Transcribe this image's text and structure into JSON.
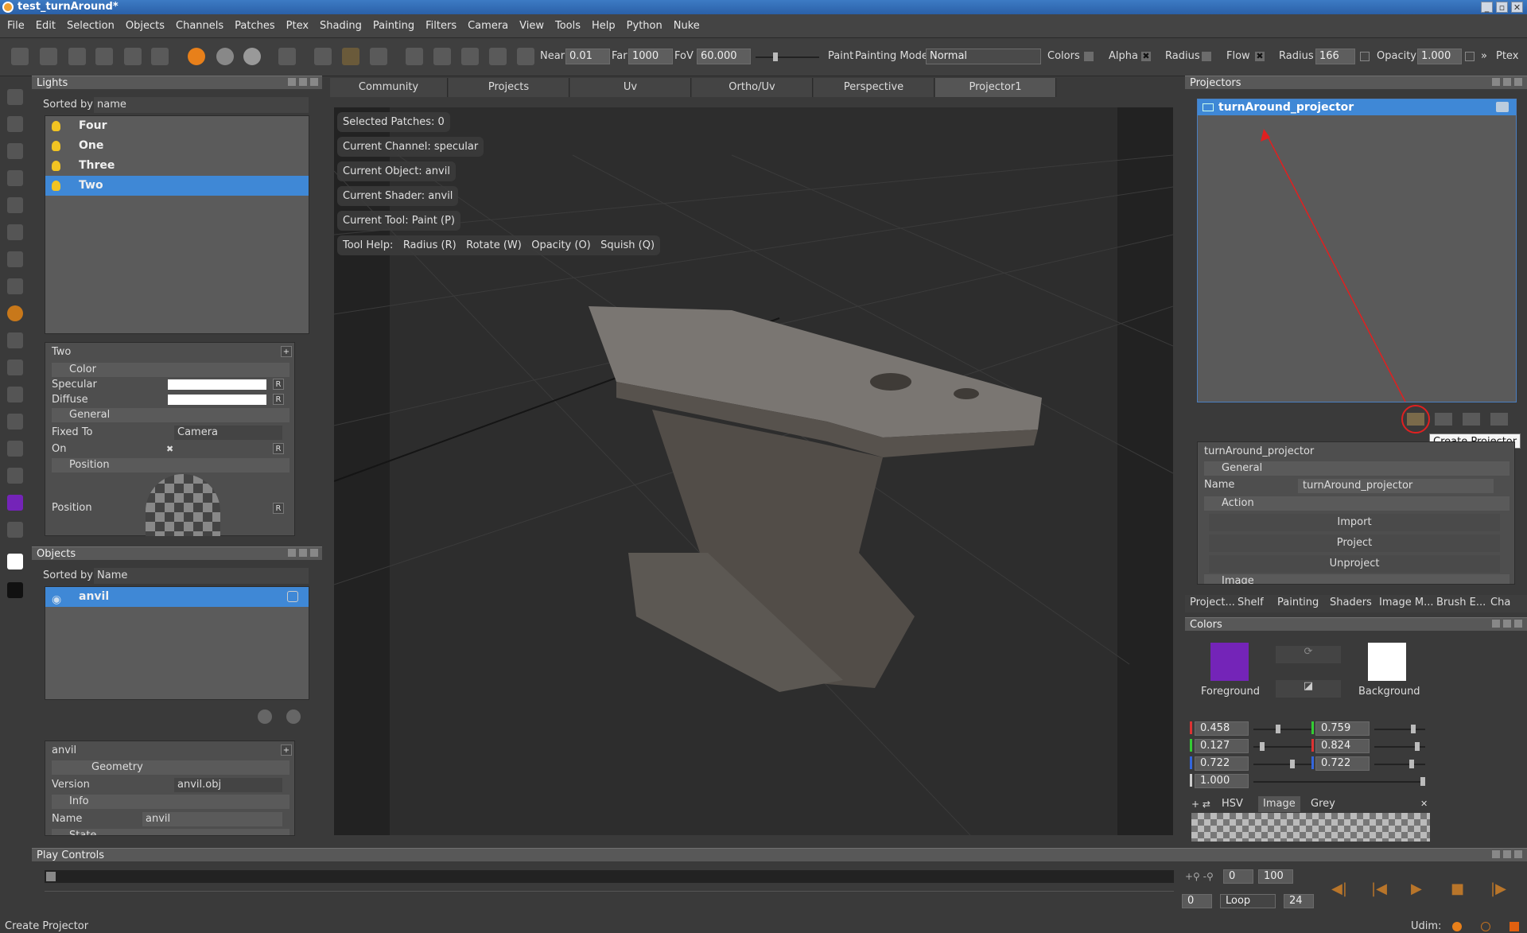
{
  "window": {
    "title": "test_turnAround*"
  },
  "menu": [
    "File",
    "Edit",
    "Selection",
    "Objects",
    "Channels",
    "Patches",
    "Ptex",
    "Shading",
    "Painting",
    "Filters",
    "Camera",
    "View",
    "Tools",
    "Help",
    "Python",
    "Nuke"
  ],
  "toolbar": {
    "near_label": "Near",
    "near_value": "0.01",
    "far_label": "Far",
    "far_value": "1000",
    "fov_label": "FoV",
    "fov_value": "60.000",
    "paint_label": "Paint",
    "painting_mode_label": "Painting Mode",
    "painting_mode_value": "Normal",
    "colors_label": "Colors",
    "alpha_label": "Alpha",
    "alpha_check": "✖",
    "radius_label": "Radius",
    "flow_label": "Flow",
    "flow_check": "✖",
    "radius2_label": "Radius",
    "radius2_value": "166",
    "opacity_label": "Opacity",
    "opacity_value": "1.000",
    "overflow": "»",
    "ptex_label": "Ptex"
  },
  "lights": {
    "header": "Lights",
    "sorted_by_label": "Sorted by",
    "sorted_by_value": "name",
    "items": [
      {
        "label": "Four"
      },
      {
        "label": "One"
      },
      {
        "label": "Three"
      },
      {
        "label": "Two"
      }
    ],
    "props": {
      "title": "Two",
      "color_section": "Color",
      "specular_label": "Specular",
      "diffuse_label": "Diffuse",
      "general_section": "General",
      "fixed_to_label": "Fixed To",
      "fixed_to_value": "Camera",
      "on_label": "On",
      "on_check": "✖",
      "position_section": "Position",
      "position_label": "Position",
      "r": "R"
    }
  },
  "objects": {
    "header": "Objects",
    "sorted_by_label": "Sorted by",
    "sorted_by_value": "Name",
    "items": [
      {
        "label": "anvil"
      }
    ],
    "props": {
      "title": "anvil",
      "geometry_section": "Geometry",
      "version_label": "Version",
      "version_value": "anvil.obj",
      "info_section": "Info",
      "name_label": "Name",
      "name_value": "anvil",
      "state_section": "State"
    }
  },
  "viewport": {
    "tabs": [
      "Community",
      "Projects",
      "Uv",
      "Ortho/Uv",
      "Perspective",
      "Projector1"
    ],
    "hud": {
      "selected_patches": "Selected Patches: 0",
      "current_channel": "Current Channel: specular",
      "current_object": "Current Object: anvil",
      "current_shader": "Current Shader: anvil",
      "current_tool": "Current Tool: Paint (P)",
      "tool_help": "Tool Help:",
      "help_radius": "Radius (R)",
      "help_rotate": "Rotate (W)",
      "help_opacity": "Opacity (O)",
      "help_squish": "Squish (Q)"
    }
  },
  "projectors": {
    "header": "Projectors",
    "items": [
      {
        "label": "turnAround_projector"
      }
    ],
    "tooltip": "Create Projector",
    "props": {
      "title": "turnAround_projector",
      "general_section": "General",
      "name_label": "Name",
      "name_value": "turnAround_projector",
      "action_section": "Action",
      "import_label": "Import",
      "project_label": "Project",
      "unproject_label": "Unproject",
      "image_section": "Image"
    }
  },
  "bottom_tabs": [
    "Project...",
    "Shelf",
    "Painting",
    "Shaders",
    "Image M...",
    "Brush E...",
    "Cha"
  ],
  "colors": {
    "header": "Colors",
    "foreground_label": "Foreground",
    "background_label": "Background",
    "foreground_color": "#7424b8",
    "background_color": "#ffffff",
    "fg_r": "0.458",
    "fg_g": "0.127",
    "fg_b": "0.722",
    "fg_a": "1.000",
    "bg_r": "0.759",
    "bg_g": "0.824",
    "bg_b": "0.722",
    "tabs": [
      "HSV",
      "Image",
      "Grey"
    ]
  },
  "play": {
    "header": "Play Controls",
    "start": "0",
    "end": "100",
    "current": "0",
    "loop": "Loop",
    "fps": "24"
  },
  "status": {
    "text": "Create Projector",
    "udim_label": "Udim:"
  }
}
